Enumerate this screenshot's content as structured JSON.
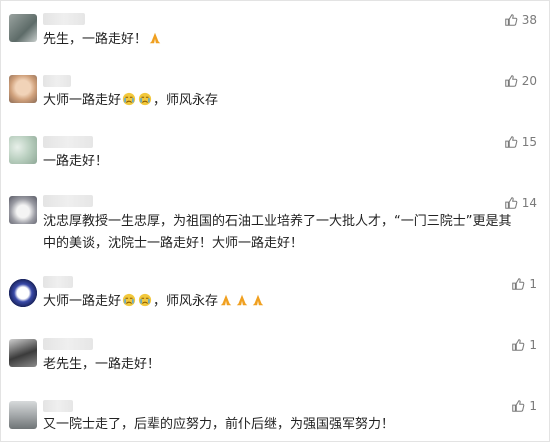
{
  "comments": [
    {
      "text": "先生，一路走好！",
      "emoji": [
        "pray"
      ],
      "likes": "38",
      "avatar": "cat-avatar"
    },
    {
      "text": "大师一路走好",
      "emoji": [
        "cry",
        "cry"
      ],
      "text2": "，师风永存",
      "likes": "20",
      "avatar": "baby-avatar"
    },
    {
      "text": "一路走好！",
      "emoji": [],
      "likes": "15",
      "avatar": "flowers-avatar"
    },
    {
      "text": "沈忠厚教授一生忠厚，为祖国的石油工业培养了一大批人才，“一门三院士”更是其\n中的美谈，沈院士一路走好！大师一路走好！",
      "emoji": [],
      "likes": "14",
      "avatar": "dog-avatar"
    },
    {
      "text": "大师一路走好",
      "emoji": [
        "cry",
        "cry"
      ],
      "text2": "，师风永存",
      "emoji2": [
        "pray",
        "pray",
        "pray"
      ],
      "likes": "1",
      "avatar": "badge-avatar"
    },
    {
      "text": "老先生，一路走好！",
      "emoji": [],
      "likes": "1",
      "avatar": "person-avatar"
    },
    {
      "text": "又一院士走了，后辈的应努力，前仆后继，为强国强军努力！",
      "emoji": [],
      "likes": "1",
      "avatar": "landscape-avatar"
    }
  ],
  "colors": {
    "text": "#222222",
    "likes": "#7a7a7a",
    "pray_emoji": "#f0a020",
    "cry_emoji": "#f2c83c"
  },
  "icons": {
    "like": "thumbs-up-icon"
  }
}
